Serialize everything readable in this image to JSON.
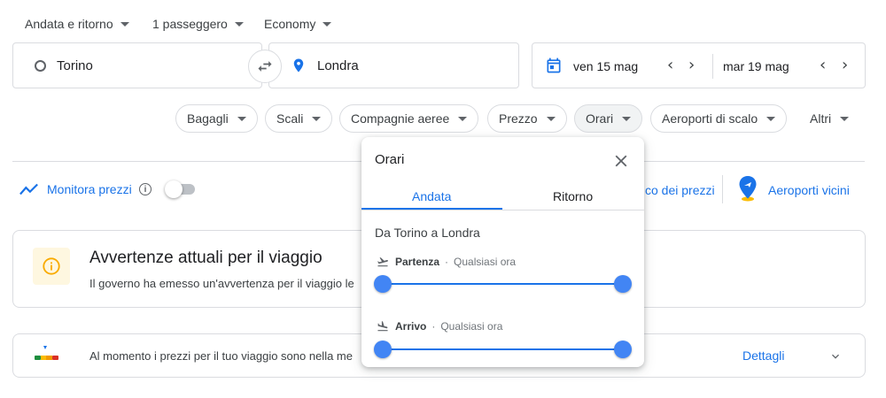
{
  "top_selectors": {
    "trip_type": "Andata e ritorno",
    "passengers": "1 passeggero",
    "cabin_class": "Economy"
  },
  "search": {
    "origin": "Torino",
    "destination": "Londra",
    "departure_date": "ven 15 mag",
    "return_date": "mar 19 mag"
  },
  "filters": {
    "chips": [
      "Bagagli",
      "Scali",
      "Compagnie aeree",
      "Prezzo",
      "Orari",
      "Aeroporti di scalo"
    ],
    "more": "Altri",
    "active": "Orari"
  },
  "monitor": {
    "label": "Monitora prezzi",
    "toggle_on": false
  },
  "right_links": {
    "price_link_partial": "co dei prezzi",
    "nearby_airports": "Aeroporti vicini"
  },
  "advisory": {
    "title": "Avvertenze attuali per il viaggio",
    "text": "Il governo ha emesso un'avvertenza per il viaggio le"
  },
  "price_insight": {
    "text": "Al momento i prezzi per il tuo viaggio sono nella me",
    "details": "Dettagli"
  },
  "popover": {
    "title": "Orari",
    "tabs": [
      "Andata",
      "Ritorno"
    ],
    "active_tab": "Andata",
    "route": "Da Torino a Londra",
    "sliders": [
      {
        "name": "Partenza",
        "sep": " · ",
        "value": "Qualsiasi ora",
        "range": [
          0,
          1
        ]
      },
      {
        "name": "Arrivo",
        "sep": " · ",
        "value": "Qualsiasi ora",
        "range": [
          0,
          1
        ]
      }
    ]
  },
  "colors": {
    "accent": "#1a73e8",
    "thumb": "#4285f4",
    "border": "#dadce0",
    "warning_bg": "#fef7e0",
    "warning_icon": "#f9ab00"
  },
  "icons": {
    "calendar": "calendar-icon",
    "location": "location-pin-icon",
    "swap": "swap-icon",
    "close": "close-icon",
    "takeoff": "takeoff-icon",
    "landing": "landing-icon"
  }
}
